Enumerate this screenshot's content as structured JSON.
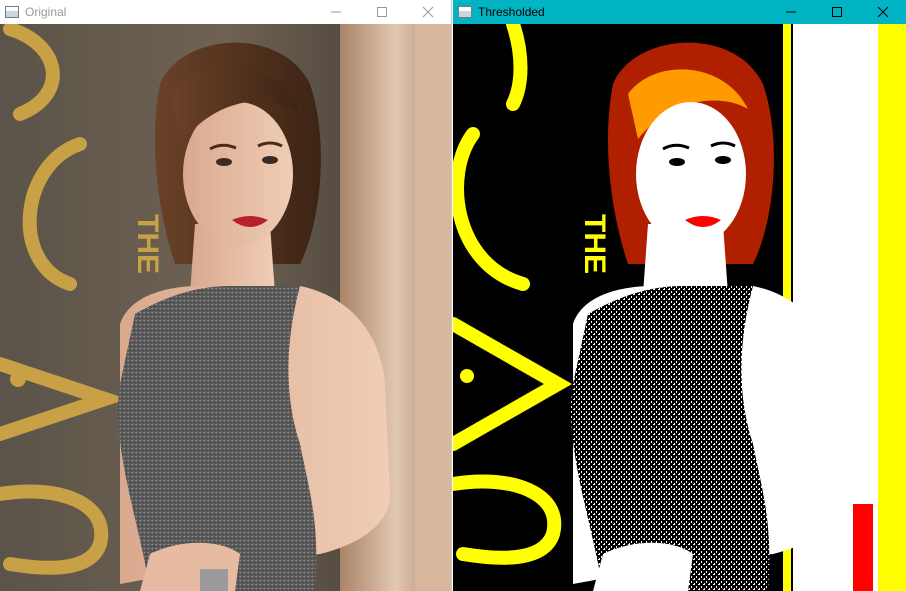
{
  "windows": [
    {
      "title": "Original",
      "controls": {
        "minimize": "minimize-icon",
        "maximize": "maximize-icon",
        "close": "close-icon"
      },
      "image": "photo of a woman in a grey sleeveless sparkly top at an awards backdrop",
      "colors": {
        "titlebar": "#ffffff",
        "title_text": "#999999",
        "backdrop": "#6a5f52",
        "gold": "#c8a046"
      }
    },
    {
      "title": "Thresholded",
      "controls": {
        "minimize": "minimize-icon",
        "maximize": "maximize-icon",
        "close": "close-icon"
      },
      "image": "posterized black/white/yellow/red thresholded version of the same photo",
      "colors": {
        "titlebar": "#00b4c4",
        "title_text": "#000000",
        "black": "#000000",
        "yellow": "#ffff00",
        "red": "#ff0000",
        "white": "#ffffff"
      }
    }
  ]
}
